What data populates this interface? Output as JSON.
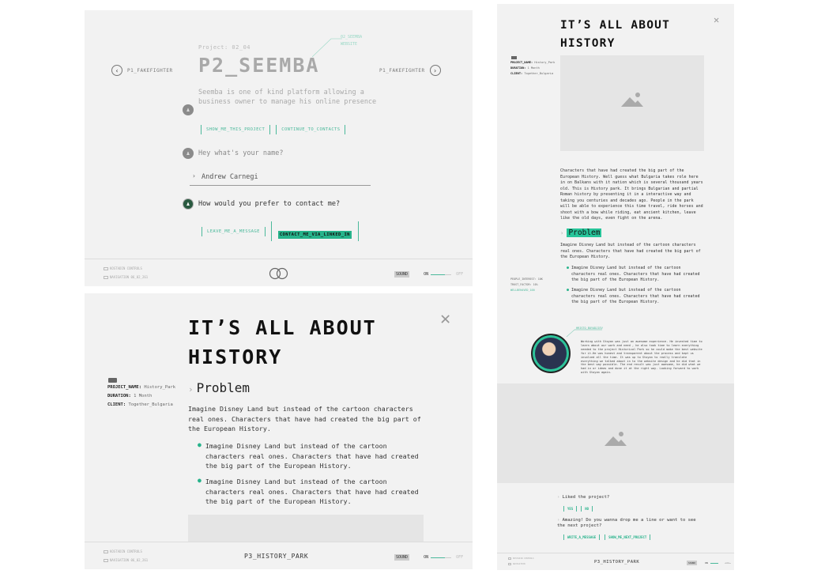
{
  "panel1": {
    "project_num": "Project: 02_04",
    "title": "P2_SEEMBA",
    "corner_note": [
      "02_SEEMBA",
      "WEBSITE"
    ],
    "prev_label": "P1_FAKEFIGHTER",
    "next_label": "P1_FAKEFIGHTER",
    "description": "Seemba is one of kind platform allowing a business owner to manage his online presence",
    "btn_show": "SHOW_ME_THIS_PROJECT",
    "btn_continue": "CONTINUE_TO_CONTACTS",
    "question_name": "Hey what's your name?",
    "answer_name": "Andrew Carnegi",
    "question_contact": "How would you prefer to contact me?",
    "btn_leave": "LEAVE_ME_A_MESSAGE",
    "btn_linkedin": "CONTACT_ME_VIA_LINKED_IN",
    "footer_left_1": "KOSTADIN CONTROLS",
    "footer_left_2": "NAVIGATION 06_02_261",
    "sound": "SOUND",
    "on": "ON",
    "off": "OFF"
  },
  "panel2": {
    "title_line1": "IT’S ALL ABOUT",
    "title_line2": "HISTORY",
    "close": "✕",
    "meta": {
      "project_name_key": "PROJECT_NAME:",
      "project_name_val": "History_Park",
      "duration_key": "DURATION:",
      "duration_val": "1 Month",
      "client_key": "CLIENT:",
      "client_val": "Together_Bulgaria"
    },
    "problem_heading": "Problem",
    "problem_text": "Imagine Disney Land but instead of the cartoon characters real ones. Characters that have had created the big part of the European History.",
    "bullets": [
      "Imagine Disney Land but instead of the cartoon characters real ones. Characters that have had created the big part of the European History.",
      "Imagine Disney Land but instead of the cartoon characters real ones. Characters that have had created the big part of the European History."
    ],
    "footer_left_1": "KOSTADIN CONTROLS",
    "footer_left_2": "NAVIGATION 06_02_261",
    "footer_title": "P3_HISTORY_PARK",
    "sound": "SOUND",
    "on": "ON",
    "off": "OFF"
  },
  "panel3": {
    "title_line1": "IT’S ALL ABOUT",
    "title_line2": "HISTORY",
    "close": "✕",
    "meta": {
      "project_name_key": "PROJECT_NAME:",
      "project_name_val": "History_Park",
      "duration_key": "DURATION:",
      "duration_val": "1 Month",
      "client_key": "CLIENT:",
      "client_val": "Together_Bulgaria"
    },
    "intro_text": "Characters that have had created the big part of the European History. Well guess what Bulgaria takes role here in on Balkans with it nation which is several thousand years old. This is History park. It brings Bulgarian and partial Roman history by presenting it in a interactive way and taking you centuries and decades ago. People in the park will be able to experience this time travel, ride horses and shoot with a bow while riding, eat ancient kitchen, leave like the old days, even fight on the arena.",
    "problem_heading": "Problem",
    "problem_text": "Imagine Disney Land but instead of the cartoon characters real ones. Characters that have had created the big part of the European History.",
    "bullets": [
      "Imagine Disney Land but instead of the cartoon characters real ones. Characters that have had created the big part of the European History.",
      "Imagine Disney Land but instead of the cartoon characters real ones. Characters that have had created the big part of the European History."
    ],
    "side_facts": [
      "PEOPLE_INTEREST: 10K",
      "TRUST_FACTOR: 10%",
      "WELLBEHAVED_100"
    ],
    "quote_label": "HRISTO_BOYADJIEV",
    "quote": "Working with Stoyan was just an awesome experience. He invested time to learn about our work and need , he also took time to learn everything needed to the project Historical Park so he could make the best website for it.He was honest and transparent about the process and kept us involved all the time. It was up to Stoyan to really translate everything we talked about in to the website design and he did that in the best way possible. The end result was just awesome, he did what we had in or ideas and done it at the right way. Looking forward to work with Stoyan again.",
    "liked_question": "Liked the project?",
    "yes": "YES",
    "no": "NO",
    "drop_question": "Amazing! Do you wanna drop me a line or want to see the next project?",
    "btn_write": "WRITE_A_MESSAGE",
    "btn_next": "SHOW_ME_NEXT_PROJECT",
    "footer_title": "P3_HISTORY_PARK",
    "footer_left_1": "KOSTADIN CONTROLS",
    "footer_left_2": "NAVIGATION",
    "sound": "SOUND",
    "on": "ON",
    "off": "OFF"
  },
  "colors": {
    "accent": "#27b38b",
    "panel_bg": "#f2f2f2"
  }
}
